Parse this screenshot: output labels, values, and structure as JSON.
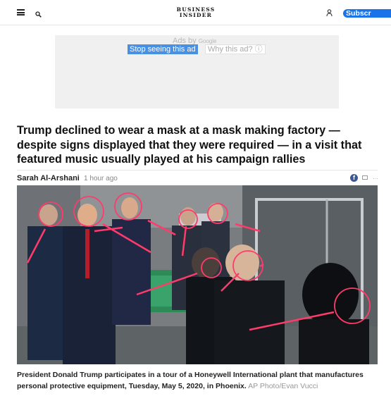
{
  "header": {
    "logo_line1": "BUSINESS",
    "logo_line2": "INSIDER",
    "subscribe_label": "Subscr",
    "icons": [
      "menu-icon",
      "search-icon",
      "user-icon"
    ]
  },
  "ad": {
    "ads_by": "Ads by",
    "google": "Google",
    "stop_label": "Stop seeing this ad",
    "why_label": "Why this ad? ⓘ"
  },
  "article": {
    "headline": "Trump declined to wear a mask at a mask making factory — despite signs displayed that they were required — in a visit that featured music usually played at his campaign rallies",
    "author": "Sarah Al-Arshani",
    "time": "1 hour ago",
    "share": {
      "facebook": "f",
      "more": "…"
    },
    "caption": "President Donald Trump participates in a tour of a Honeywell International plant that manufactures personal protective equipment, Tuesday, May 5, 2020, in Phoenix.",
    "credit": "AP Photo/Evan Vucci"
  },
  "colors": {
    "subscribe": "#1a73e8",
    "ad_bg": "#f0f0f0",
    "stop_button": "#4a90e2",
    "annotation": "#ff3b6b"
  }
}
